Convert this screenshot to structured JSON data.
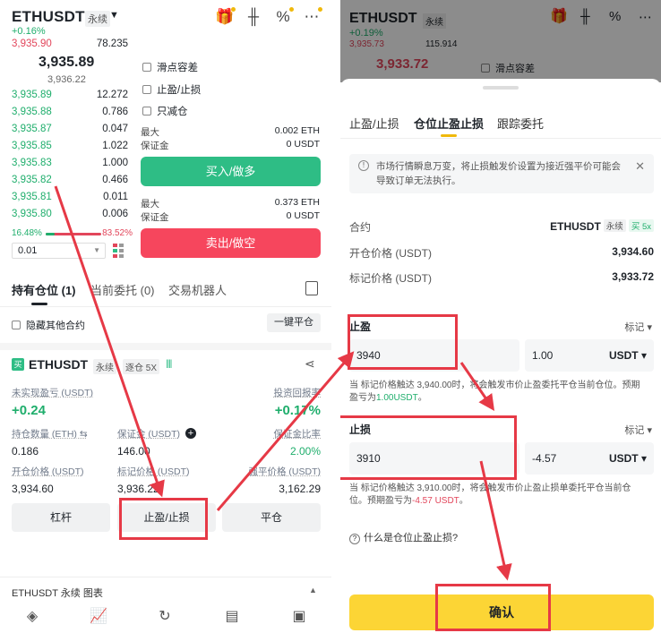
{
  "left": {
    "header": {
      "symbol": "ETHUSDT",
      "contract": "永续",
      "change": "+0.16%"
    },
    "orderbook": {
      "top_ask": {
        "price": "3,935.90",
        "qty": "78.235"
      },
      "last_price": "3,935.89",
      "mark_price": "3,936.22",
      "bids": [
        {
          "price": "3,935.89",
          "qty": "12.272"
        },
        {
          "price": "3,935.88",
          "qty": "0.786"
        },
        {
          "price": "3,935.87",
          "qty": "0.047"
        },
        {
          "price": "3,935.85",
          "qty": "1.022"
        },
        {
          "price": "3,935.83",
          "qty": "1.000"
        },
        {
          "price": "3,935.82",
          "qty": "0.466"
        },
        {
          "price": "3,935.81",
          "qty": "0.011"
        },
        {
          "price": "3,935.80",
          "qty": "0.006"
        }
      ],
      "buy_ratio": "16.48%",
      "sell_ratio": "83.52%",
      "buy_ratio_fraction": 0.1648,
      "step": "0.01"
    },
    "order_form": {
      "options": [
        "滑点容差",
        "止盈/止损",
        "只减仓"
      ],
      "buy_max_label": "最大",
      "buy_max_value": "0.002 ETH",
      "buy_margin_label": "保证金",
      "buy_margin_value": "0 USDT",
      "buy_button": "买入/做多",
      "sell_max_label": "最大",
      "sell_max_value": "0.373 ETH",
      "sell_margin_label": "保证金",
      "sell_margin_value": "0 USDT",
      "sell_button": "卖出/做空"
    },
    "tabs": [
      "持有仓位 (1)",
      "当前委托 (0)",
      "交易机器人"
    ],
    "hide_other": "隐藏其他合约",
    "close_all": "一键平仓",
    "position": {
      "side": "买",
      "symbol": "ETHUSDT",
      "contract": "永续",
      "margin_mode": "逐仓 5X",
      "bars": "||||",
      "unrealized_label": "未实现盈亏 (USDT)",
      "unrealized_value": "+0.24",
      "roi_label": "投资回报率",
      "roi_value": "+0.17%",
      "qty_label": "持仓数量 (ETH) ⇆",
      "qty_value": "0.186",
      "margin_label": "保证金 (USDT)",
      "margin_value": "146.00",
      "margin_ratio_label": "保证金比率",
      "margin_ratio_value": "2.00%",
      "entry_label": "开仓价格 (USDT)",
      "entry_value": "3,934.60",
      "mark_label": "标记价格 (USDT)",
      "mark_value": "3,936.22",
      "liq_label": "强平价格 (USDT)",
      "liq_value": "3,162.29"
    },
    "actions": [
      "杠杆",
      "止盈/止损",
      "平仓"
    ],
    "footer": {
      "title": "ETHUSDT 永续  图表"
    },
    "nav_icons": [
      "diamond-icon",
      "chart-icon",
      "swap-icon",
      "orders-icon",
      "wallet-icon"
    ]
  },
  "right": {
    "dim_header": {
      "symbol": "ETHUSDT",
      "contract": "永续",
      "change": "+0.19%",
      "ask_price": "3,935.73",
      "ask_qty": "115.914",
      "last_price": "3,933.72",
      "option": "滑点容差"
    },
    "tabs": [
      "止盈/止损",
      "仓位止盈止损",
      "跟踪委托"
    ],
    "notice": "市场行情瞬息万变，将止损触发价设置为接近强平价可能会导致订单无法执行。",
    "contract_label": "合约",
    "contract_value": "ETHUSDT",
    "contract_tag": "永续",
    "contract_side": "买 5x",
    "entry_label": "开仓价格 (USDT)",
    "entry_value": "3,934.60",
    "mark_label": "标记价格 (USDT)",
    "mark_value": "3,933.72",
    "take_profit": {
      "label": "止盈",
      "trigger": "标记 ▾",
      "price": "3940",
      "pnl": "1.00",
      "unit": "USDT ▾",
      "hint_pre": "当 标记价格触达 3,940.00时，将会触发市价止盈委托平仓当前仓位。预期盈亏为",
      "hint_val": "1.00USDT",
      "hint_post": "。"
    },
    "stop_loss": {
      "label": "止损",
      "trigger": "标记 ▾",
      "price": "3910",
      "pnl": "-4.57",
      "unit": "USDT ▾",
      "hint_pre": "当 标记价格触达 3,910.00时，将会触发市价止盈止损单委托平仓当前仓位。预期盈亏为",
      "hint_val": "-4.57 USDT",
      "hint_post": "。"
    },
    "faq": "什么是仓位止盈止损?",
    "confirm": "确认"
  },
  "colors": {
    "green": "#2ebd85",
    "red": "#f6465d",
    "yellow": "#fcd535",
    "annotation": "#e63946"
  }
}
